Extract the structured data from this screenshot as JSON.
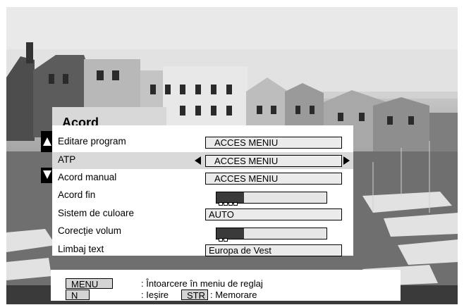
{
  "menu": {
    "title": "Acord",
    "items": [
      {
        "label": "Editare program",
        "value": "ACCES MENIU"
      },
      {
        "label": "ATP",
        "value": "ACCES MENIU"
      },
      {
        "label": "Acord manual",
        "value": "ACCES MENIU"
      },
      {
        "label": "Acord fin",
        "level": 0.25
      },
      {
        "label": "Sistem de culoare",
        "value": "AUTO"
      },
      {
        "label": "Corecție volum",
        "level": 0.25
      },
      {
        "label": "Limbaj text",
        "value": "Europa de Vest"
      }
    ],
    "selected_index": 1
  },
  "help": {
    "menu_key": "MENU",
    "menu_text": ": Întoarcere în meniu de reglaj",
    "n_key": "N",
    "n_text": ": Ieşire",
    "str_key": "STR",
    "str_text": ": Memorare"
  },
  "colors": {
    "selected_row": "#d9d9d9",
    "bar_fill": "#3a3a3a",
    "field_bg": "#ebebeb"
  },
  "icons": {
    "up": "triangle-up-icon",
    "down": "triangle-down-icon",
    "left": "triangle-left-icon",
    "right": "triangle-right-icon"
  }
}
